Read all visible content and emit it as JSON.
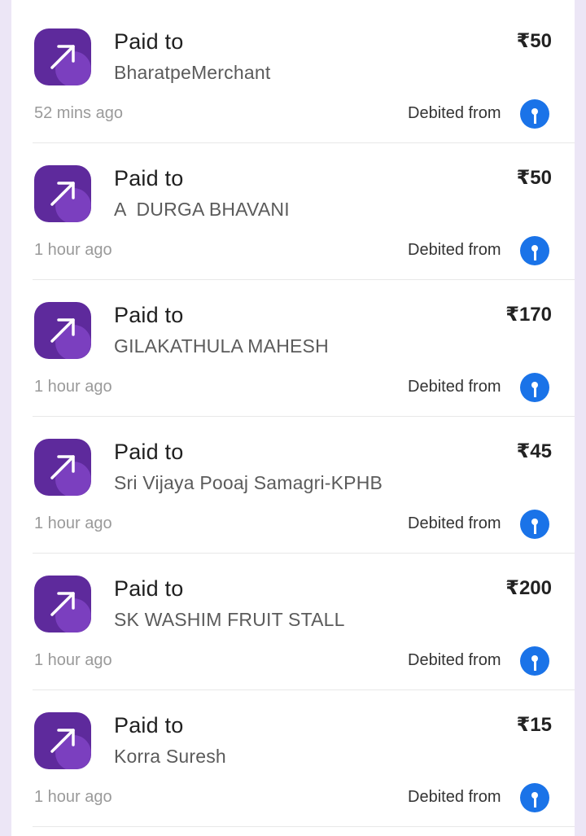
{
  "transactions": [
    {
      "title": "Paid to",
      "name": "BharatpeMerchant",
      "amount": "₹50",
      "time": "52 mins ago",
      "debited_label": "Debited from",
      "icon": "arrow-up-right-icon",
      "bank_icon": "sbi-bank-icon"
    },
    {
      "title": "Paid to",
      "name": "A  DURGA BHAVANI",
      "amount": "₹50",
      "time": "1 hour ago",
      "debited_label": "Debited from",
      "icon": "arrow-up-right-icon",
      "bank_icon": "sbi-bank-icon"
    },
    {
      "title": "Paid to",
      "name": "GILAKATHULA MAHESH",
      "amount": "₹170",
      "time": "1 hour ago",
      "debited_label": "Debited from",
      "icon": "arrow-up-right-icon",
      "bank_icon": "sbi-bank-icon"
    },
    {
      "title": "Paid to",
      "name": "Sri Vijaya Pooaj Samagri-KPHB",
      "amount": "₹45",
      "time": "1 hour ago",
      "debited_label": "Debited from",
      "icon": "arrow-up-right-icon",
      "bank_icon": "sbi-bank-icon"
    },
    {
      "title": "Paid to",
      "name": "SK WASHIM FRUIT STALL",
      "amount": "₹200",
      "time": "1 hour ago",
      "debited_label": "Debited from",
      "icon": "arrow-up-right-icon",
      "bank_icon": "sbi-bank-icon"
    },
    {
      "title": "Paid to",
      "name": "Korra Suresh",
      "amount": "₹15",
      "time": "1 hour ago",
      "debited_label": "Debited from",
      "icon": "arrow-up-right-icon",
      "bank_icon": "sbi-bank-icon"
    }
  ],
  "colors": {
    "accent_purple": "#5e2a9c",
    "bank_blue": "#1a73e8",
    "background_lavender": "#ece6f6"
  }
}
